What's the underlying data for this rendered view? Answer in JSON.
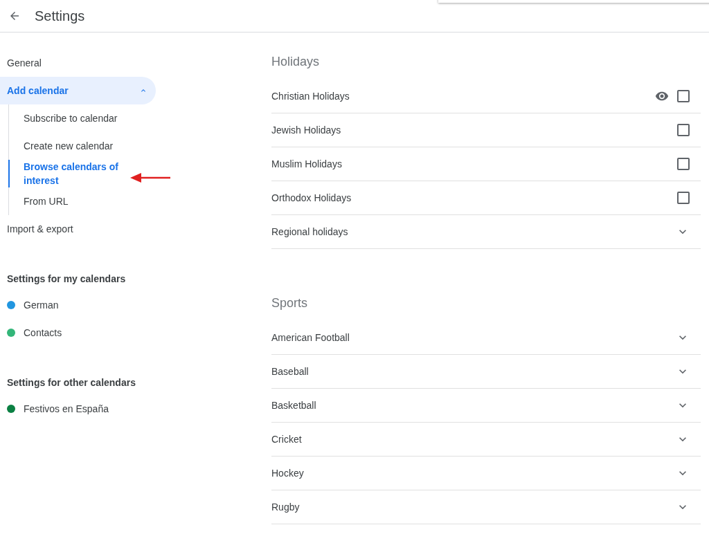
{
  "header": {
    "title": "Settings"
  },
  "sidebar": {
    "items": [
      {
        "label": "General",
        "selected": false
      },
      {
        "label": "Add calendar",
        "selected": true,
        "expanded": true,
        "children": [
          {
            "label": "Subscribe to calendar",
            "selected": false
          },
          {
            "label": "Create new calendar",
            "selected": false
          },
          {
            "label": "Browse calendars of interest",
            "selected": true
          },
          {
            "label": "From URL",
            "selected": false
          }
        ]
      },
      {
        "label": "Import & export",
        "selected": false
      }
    ],
    "sections": [
      {
        "title": "Settings for my calendars",
        "calendars": [
          {
            "label": "German",
            "color": "#2196e0"
          },
          {
            "label": "Contacts",
            "color": "#33b679"
          }
        ]
      },
      {
        "title": "Settings for other calendars",
        "calendars": [
          {
            "label": "Festivos en España",
            "color": "#0b8043"
          }
        ]
      }
    ]
  },
  "groups": [
    {
      "title": "Holidays",
      "rows": [
        {
          "label": "Christian Holidays",
          "kind": "checkbox",
          "checked": false,
          "preview": true
        },
        {
          "label": "Jewish Holidays",
          "kind": "checkbox",
          "checked": false,
          "preview": false
        },
        {
          "label": "Muslim Holidays",
          "kind": "checkbox",
          "checked": false,
          "preview": false
        },
        {
          "label": "Orthodox Holidays",
          "kind": "checkbox",
          "checked": false,
          "preview": false
        },
        {
          "label": "Regional holidays",
          "kind": "expand",
          "expanded": false
        }
      ]
    },
    {
      "title": "Sports",
      "rows": [
        {
          "label": "American Football",
          "kind": "expand",
          "expanded": false
        },
        {
          "label": "Baseball",
          "kind": "expand",
          "expanded": false
        },
        {
          "label": "Basketball",
          "kind": "expand",
          "expanded": false
        },
        {
          "label": "Cricket",
          "kind": "expand",
          "expanded": false
        },
        {
          "label": "Hockey",
          "kind": "expand",
          "expanded": false
        },
        {
          "label": "Rugby",
          "kind": "expand",
          "expanded": false
        }
      ]
    }
  ]
}
